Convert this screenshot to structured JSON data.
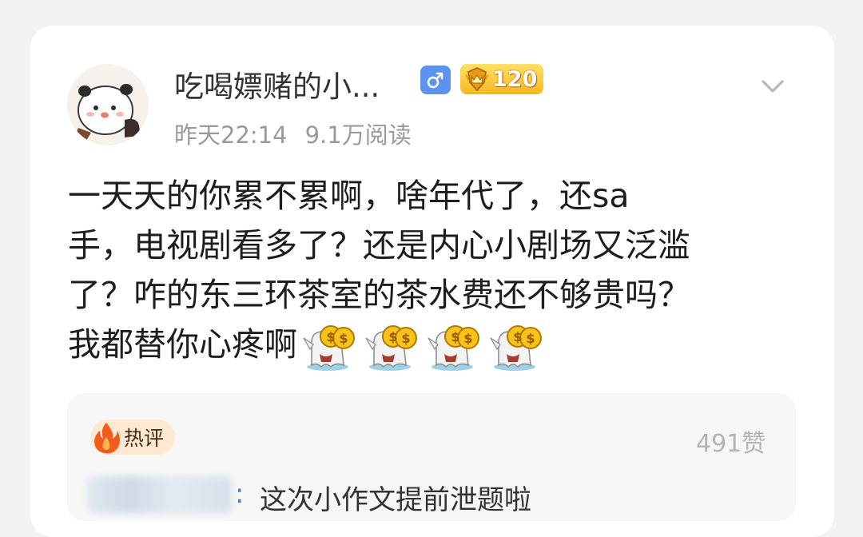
{
  "post": {
    "author": {
      "name": "吃喝嫖赌的小...",
      "gender_icon": "male-icon",
      "level": "120"
    },
    "meta": {
      "time": "昨天22:14",
      "reads": "9.1万阅读"
    },
    "body_lines": [
      "一天天的你累不累啊，啥年代了，还sa",
      "手，电视剧看多了？还是内心小剧场又泛滥",
      "了？咋的东三环茶室的茶水费还不够贵吗？",
      "我都替你心疼啊"
    ],
    "emoji_icon": "money-ghost-emoji-icon"
  },
  "hot_comment": {
    "badge_label": "热评",
    "likes": "491赞",
    "separator": ":",
    "text": "这次小作文提前泄题啦"
  },
  "colors": {
    "accent_blue": "#5b93ee",
    "level_gold": "#f6b81f",
    "hot_badge_bg": "#fde9d2",
    "muted_text": "#9a9a9a"
  }
}
